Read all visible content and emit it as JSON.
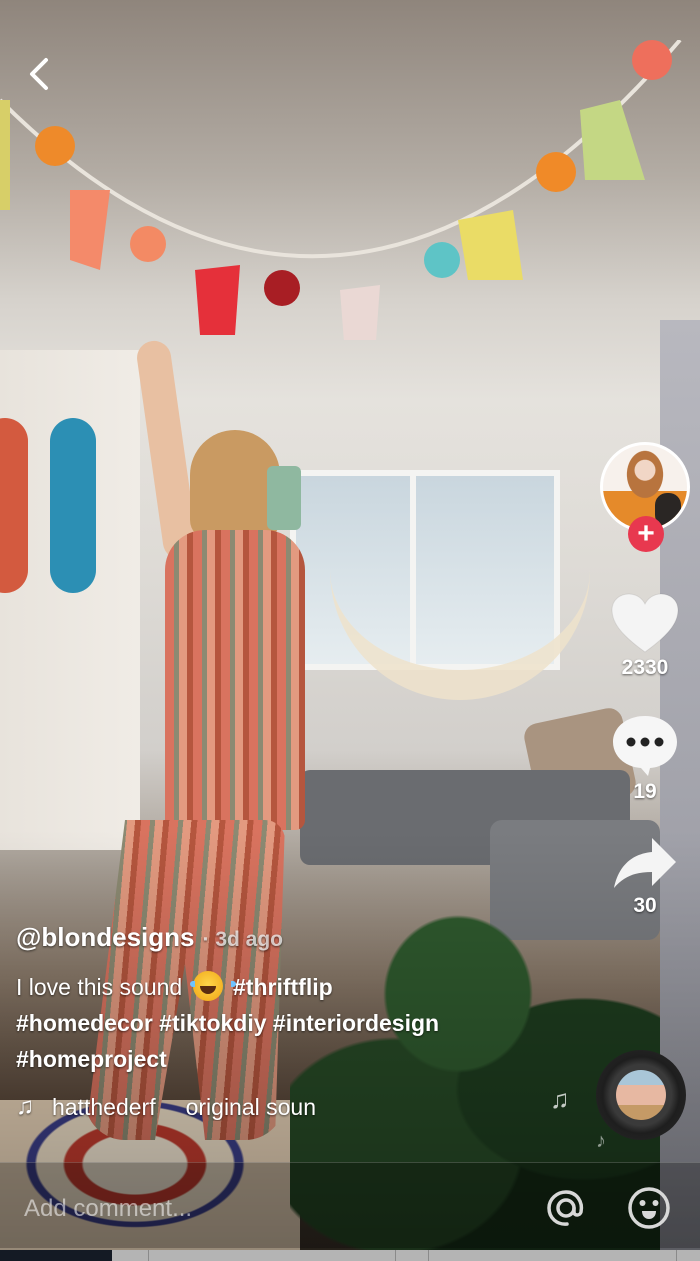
{
  "navigation": {
    "back_icon": "chevron-left-icon"
  },
  "author": {
    "handle": "@blondesigns",
    "separator": "·",
    "time_ago": "3d ago"
  },
  "caption": {
    "text": "I love this sound",
    "emoji": "face-with-tears-of-joy",
    "hashtags": [
      "#thriftflip",
      "#homedecor",
      "#tiktokdiy",
      "#interiordesign",
      "#homeproject"
    ]
  },
  "music": {
    "icon": "music-note-icon",
    "artist_fragment": "hatthederf",
    "title_fragment": "original soun"
  },
  "actions": {
    "follow_icon": "plus-icon",
    "like": {
      "icon": "heart-icon",
      "count": "2330"
    },
    "comment": {
      "icon": "comment-bubble-icon",
      "count": "19"
    },
    "share": {
      "icon": "share-arrow-icon",
      "count": "30"
    }
  },
  "comment_bar": {
    "placeholder": "Add comment...",
    "mention_icon": "at-sign-icon",
    "emoji_icon": "smiley-icon"
  },
  "colors": {
    "follow_accent": "#e8384f",
    "text": "#ffffff"
  }
}
